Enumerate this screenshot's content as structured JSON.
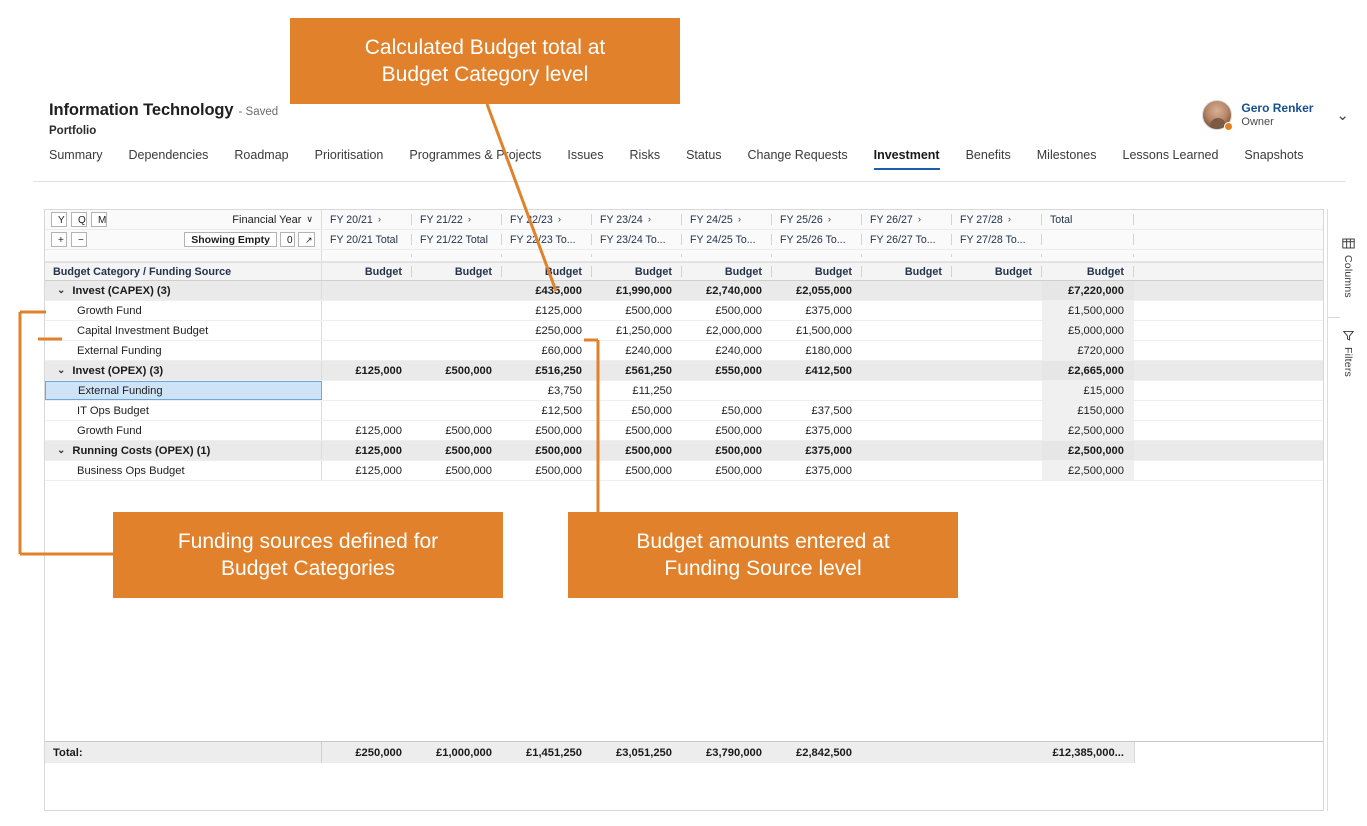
{
  "header": {
    "title": "Information Technology",
    "saved": "- Saved",
    "subtitle": "Portfolio"
  },
  "user": {
    "name": "Gero Renker",
    "role": "Owner",
    "chevron": "⌄"
  },
  "nav": {
    "tabs": [
      {
        "label": "Summary",
        "active": false
      },
      {
        "label": "Dependencies",
        "active": false
      },
      {
        "label": "Roadmap",
        "active": false
      },
      {
        "label": "Prioritisation",
        "active": false
      },
      {
        "label": "Programmes & Projects",
        "active": false
      },
      {
        "label": "Issues",
        "active": false
      },
      {
        "label": "Risks",
        "active": false
      },
      {
        "label": "Status",
        "active": false
      },
      {
        "label": "Change Requests",
        "active": false
      },
      {
        "label": "Investment",
        "active": true
      },
      {
        "label": "Benefits",
        "active": false
      },
      {
        "label": "Milestones",
        "active": false
      },
      {
        "label": "Lessons Learned",
        "active": false
      },
      {
        "label": "Snapshots",
        "active": false
      }
    ]
  },
  "toolbar": {
    "scale_buttons": [
      "Y",
      "Q",
      "M"
    ],
    "period_selector": "Financial Year",
    "period_caret": "∨",
    "expand_button": "+",
    "collapse_button": "−",
    "showing_empty_label": "Showing Empty",
    "showing_empty_count": "0",
    "popout_icon": "↗"
  },
  "grid": {
    "row_header_label": "Budget Category / Funding Source",
    "measure_label": "Budget",
    "fy_chevron": "›",
    "columns": [
      {
        "fy": "FY 20/21",
        "total": "FY 20/21 Total",
        "measure": "Budget"
      },
      {
        "fy": "FY 21/22",
        "total": "FY 21/22 Total",
        "measure": "Budget"
      },
      {
        "fy": "FY 22/23",
        "total": "FY 22/23 To...",
        "measure": "Budget"
      },
      {
        "fy": "FY 23/24",
        "total": "FY 23/24 To...",
        "measure": "Budget"
      },
      {
        "fy": "FY 24/25",
        "total": "FY 24/25 To...",
        "measure": "Budget"
      },
      {
        "fy": "FY 25/26",
        "total": "FY 25/26 To...",
        "measure": "Budget"
      },
      {
        "fy": "FY 26/27",
        "total": "FY 26/27 To...",
        "measure": "Budget"
      },
      {
        "fy": "FY 27/28",
        "total": "FY 27/28 To...",
        "measure": "Budget"
      },
      {
        "fy": "Total",
        "total": "",
        "measure": "Budget"
      }
    ],
    "rows": [
      {
        "label": "Invest (CAPEX) (3)",
        "type": "group",
        "caret": "⌄",
        "selected": false,
        "values": [
          "",
          "",
          "£435,000",
          "£1,990,000",
          "£2,740,000",
          "£2,055,000",
          "",
          "",
          "£7,220,000"
        ]
      },
      {
        "label": "Growth Fund",
        "type": "child",
        "selected": false,
        "values": [
          "",
          "",
          "£125,000",
          "£500,000",
          "£500,000",
          "£375,000",
          "",
          "",
          "£1,500,000"
        ]
      },
      {
        "label": "Capital Investment Budget",
        "type": "child",
        "selected": false,
        "values": [
          "",
          "",
          "£250,000",
          "£1,250,000",
          "£2,000,000",
          "£1,500,000",
          "",
          "",
          "£5,000,000"
        ]
      },
      {
        "label": "External Funding",
        "type": "child",
        "selected": false,
        "values": [
          "",
          "",
          "£60,000",
          "£240,000",
          "£240,000",
          "£180,000",
          "",
          "",
          "£720,000"
        ]
      },
      {
        "label": "Invest (OPEX) (3)",
        "type": "group",
        "caret": "⌄",
        "selected": false,
        "values": [
          "£125,000",
          "£500,000",
          "£516,250",
          "£561,250",
          "£550,000",
          "£412,500",
          "",
          "",
          "£2,665,000"
        ]
      },
      {
        "label": "External Funding",
        "type": "child",
        "selected": true,
        "values": [
          "",
          "",
          "£3,750",
          "£11,250",
          "",
          "",
          "",
          "",
          "£15,000"
        ]
      },
      {
        "label": "IT Ops Budget",
        "type": "child",
        "selected": false,
        "values": [
          "",
          "",
          "£12,500",
          "£50,000",
          "£50,000",
          "£37,500",
          "",
          "",
          "£150,000"
        ]
      },
      {
        "label": "Growth Fund",
        "type": "child",
        "selected": false,
        "values": [
          "£125,000",
          "£500,000",
          "£500,000",
          "£500,000",
          "£500,000",
          "£375,000",
          "",
          "",
          "£2,500,000"
        ]
      },
      {
        "label": "Running Costs (OPEX) (1)",
        "type": "group",
        "caret": "⌄",
        "selected": false,
        "values": [
          "£125,000",
          "£500,000",
          "£500,000",
          "£500,000",
          "£500,000",
          "£375,000",
          "",
          "",
          "£2,500,000"
        ]
      },
      {
        "label": "Business Ops Budget",
        "type": "child",
        "selected": false,
        "values": [
          "£125,000",
          "£500,000",
          "£500,000",
          "£500,000",
          "£500,000",
          "£375,000",
          "",
          "",
          "£2,500,000"
        ]
      }
    ],
    "footer": {
      "label": "Total:",
      "values": [
        "£250,000",
        "£1,000,000",
        "£1,451,250",
        "£3,051,250",
        "£3,790,000",
        "£2,842,500",
        "",
        "",
        "£12,385,000..."
      ]
    }
  },
  "rail": {
    "columns_label": "Columns",
    "filters_label": "Filters"
  },
  "callouts": {
    "top_line1": "Calculated Budget total at",
    "top_line2": "Budget Category level",
    "left_line1": "Funding sources defined for",
    "left_line2": "Budget Categories",
    "mid_line1": "Budget amounts entered at",
    "mid_line2": "Funding Source level"
  },
  "colors": {
    "accent_orange": "#e1812c",
    "tab_active_underline": "#1b5fa8",
    "selection_blue": "#cfe3f7"
  }
}
